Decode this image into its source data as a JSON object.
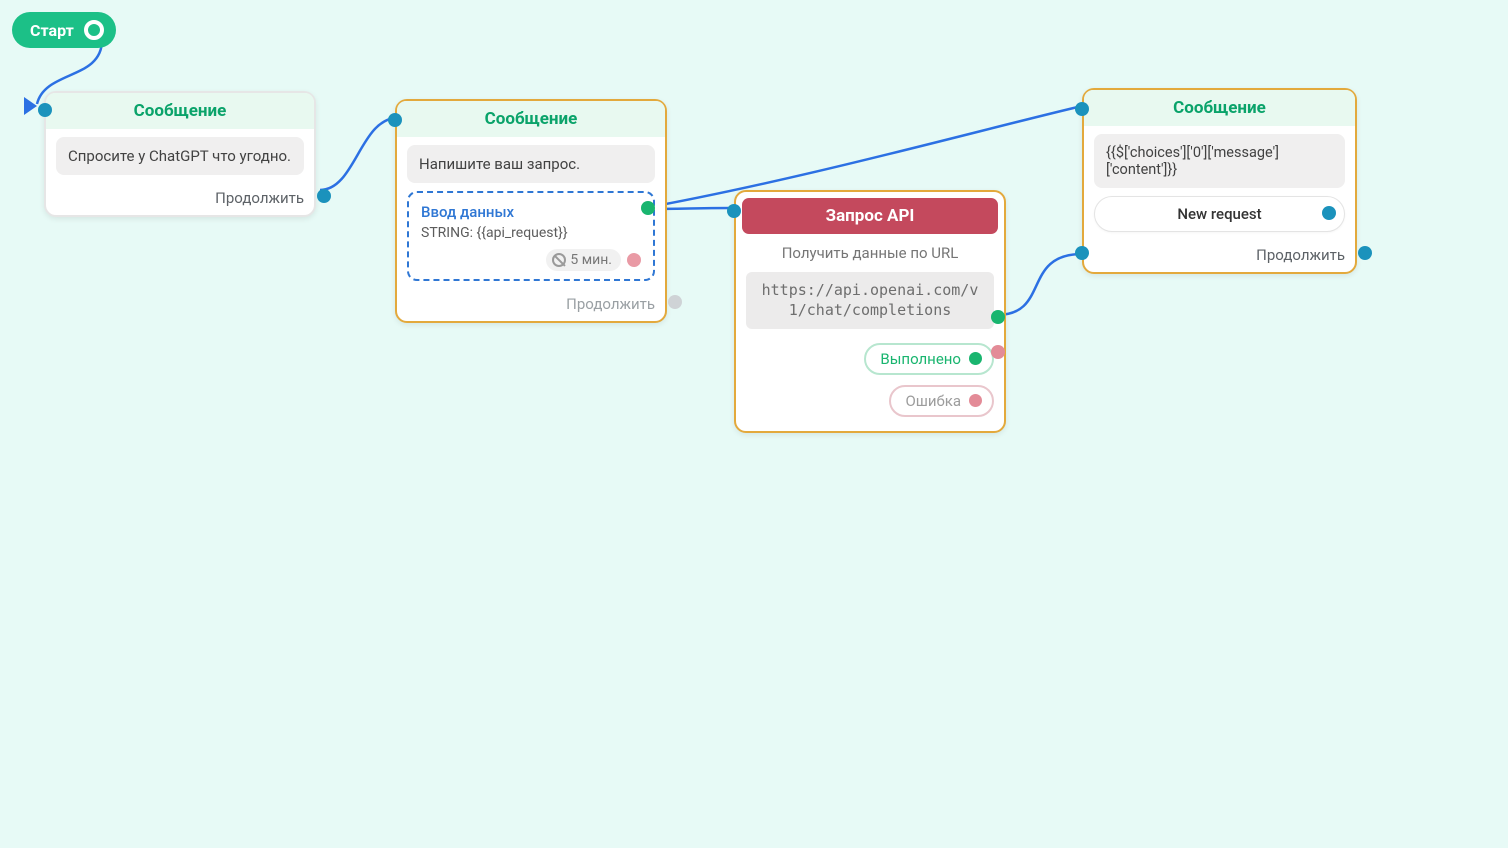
{
  "colors": {
    "canvas_bg": "#e7faf6",
    "connection": "#2c70e3",
    "port_blue": "#1b92bc",
    "port_green": "#19b56f",
    "port_pink": "#e38b97",
    "accent_green": "#1cc087",
    "accent_red": "#c4495d",
    "node_border": "#e3a93c"
  },
  "start": {
    "label": "Старт"
  },
  "labels": {
    "continue": "Продолжить"
  },
  "node1": {
    "title": "Сообщение",
    "body": "Спросите у ChatGPT что угодно."
  },
  "node2": {
    "title": "Сообщение",
    "body": "Напишите ваш запрос.",
    "input": {
      "title": "Ввод данных",
      "var_prefix": "STRING: ",
      "var": "{{api_request}}",
      "timeout": "5 мин."
    }
  },
  "node3": {
    "title": "Запрос API",
    "subtitle": "Получить данные по URL",
    "url": "https://api.openai.com/v1/chat/completions",
    "status_ok": "Выполнено",
    "status_err": "Ошибка"
  },
  "node4": {
    "title": "Сообщение",
    "body": "{{$['choices']['0']['message']['content']}}",
    "chip": "New request"
  }
}
